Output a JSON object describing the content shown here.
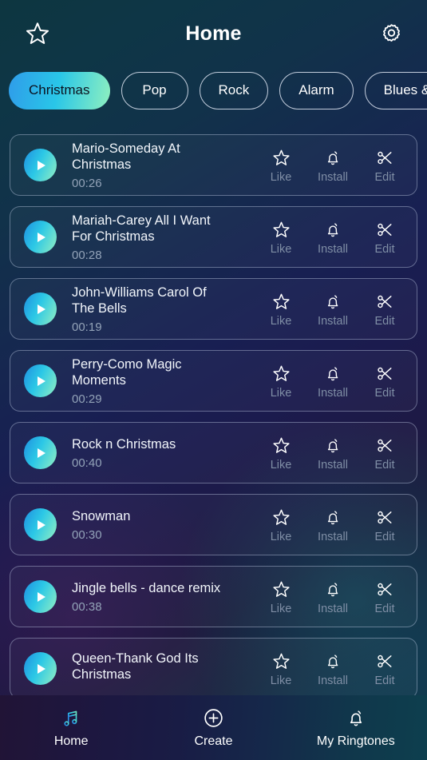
{
  "header": {
    "title": "Home",
    "left_icon": "star-outline-icon",
    "right_icon": "gear-icon"
  },
  "categories": [
    {
      "label": "Christmas",
      "active": true
    },
    {
      "label": "Pop",
      "active": false
    },
    {
      "label": "Rock",
      "active": false
    },
    {
      "label": "Alarm",
      "active": false
    },
    {
      "label": "Blues &",
      "active": false
    }
  ],
  "actions": {
    "like": "Like",
    "install": "Install",
    "edit": "Edit"
  },
  "ringtones": [
    {
      "title": "Mario-Someday At Christmas",
      "duration": "00:26"
    },
    {
      "title": "Mariah-Carey All I Want For Christmas",
      "duration": "00:28"
    },
    {
      "title": "John-Williams Carol Of The Bells",
      "duration": "00:19"
    },
    {
      "title": "Perry-Como Magic Moments",
      "duration": "00:29"
    },
    {
      "title": "Rock n Christmas",
      "duration": "00:40"
    },
    {
      "title": "Snowman",
      "duration": "00:30"
    },
    {
      "title": "Jingle bells - dance remix",
      "duration": "00:38"
    },
    {
      "title": "Queen-Thank God Its Christmas",
      "duration": ""
    }
  ],
  "bottom_nav": [
    {
      "label": "Home",
      "icon": "music-note-icon",
      "active": true
    },
    {
      "label": "Create",
      "icon": "plus-circle-icon",
      "active": false
    },
    {
      "label": "My Ringtones",
      "icon": "bell-icon",
      "active": false
    }
  ],
  "colors": {
    "accent_start": "#2f9ce9",
    "accent_mid": "#29c6e8",
    "accent_end": "#8ff0bf",
    "text_primary": "#f2f6fb",
    "text_muted": "#7f8ea5",
    "card_border": "#c4d0e6"
  }
}
